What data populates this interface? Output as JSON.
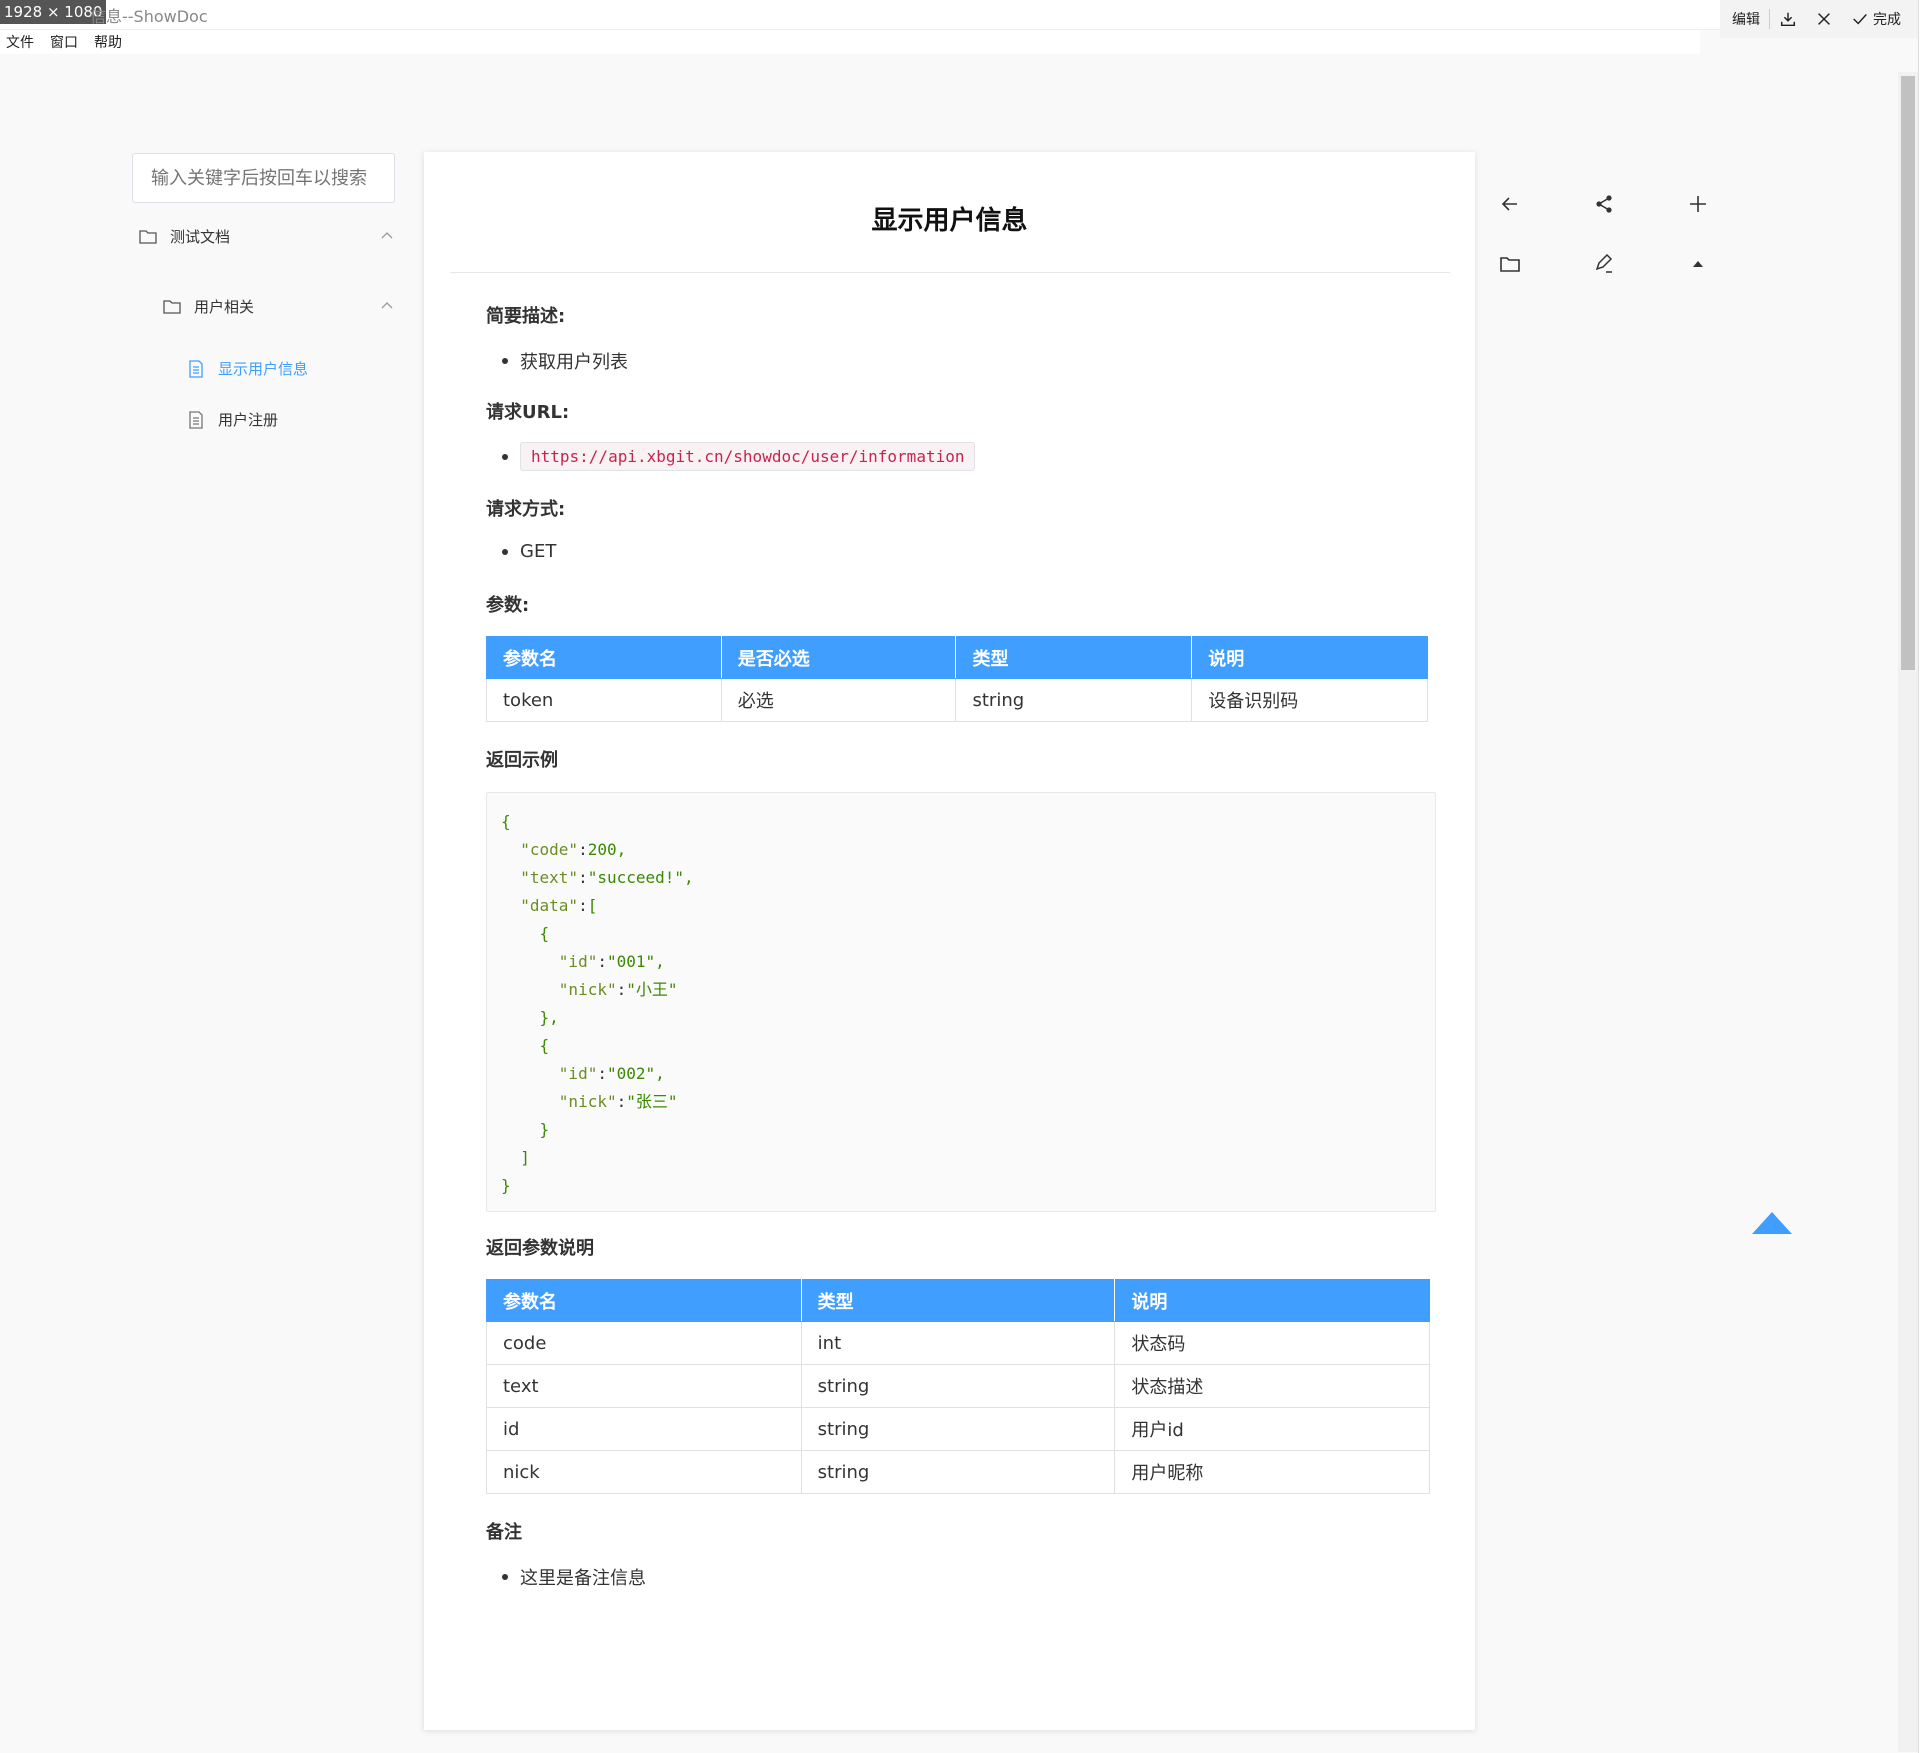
{
  "window": {
    "dimension_badge": "1928 × 1080",
    "title_fragment": "信息--ShowDoc"
  },
  "title_actions": {
    "edit_label": "编辑",
    "done_label": "完成"
  },
  "menubar": {
    "items": [
      "文件",
      "窗口",
      "帮助"
    ]
  },
  "sidebar": {
    "search_placeholder": "输入关键字后按回车以搜索",
    "tree": [
      {
        "label": "测试文档",
        "type": "folder"
      },
      {
        "label": "用户相关",
        "type": "folder"
      },
      {
        "label": "显示用户信息",
        "type": "page",
        "active": true
      },
      {
        "label": "用户注册",
        "type": "page"
      }
    ]
  },
  "doc": {
    "title": "显示用户信息",
    "desc_heading": "简要描述:",
    "desc_item": "获取用户列表",
    "url_heading": "请求URL:",
    "url_item": "https://api.xbgit.cn/showdoc/user/information",
    "method_heading": "请求方式:",
    "method_item": "GET",
    "params_heading": "参数:",
    "params_table": {
      "headers": [
        "参数名",
        "是否必选",
        "类型",
        "说明"
      ],
      "rows": [
        [
          "token",
          "必选",
          "string",
          "设备识别码"
        ]
      ]
    },
    "example_heading": "返回示例",
    "example_lines": [
      "{",
      "  \"code\":200,",
      "  \"text\":\"succeed!\",",
      "  \"data\":[",
      "    {",
      "      \"id\":\"001\",",
      "      \"nick\":\"小王\"",
      "    },",
      "    {",
      "      \"id\":\"002\",",
      "      \"nick\":\"张三\"",
      "    }",
      "  ]",
      "}"
    ],
    "return_heading": "返回参数说明",
    "return_table": {
      "headers": [
        "参数名",
        "类型",
        "说明"
      ],
      "rows": [
        [
          "code",
          "int",
          "状态码"
        ],
        [
          "text",
          "string",
          "状态描述"
        ],
        [
          "id",
          "string",
          "用户id"
        ],
        [
          "nick",
          "string",
          "用户昵称"
        ]
      ]
    },
    "note_heading": "备注",
    "note_item": "这里是备注信息"
  },
  "colors": {
    "accent": "#409eff",
    "url_code": "#c7254e"
  },
  "icons": {
    "toolbar": [
      "arrow-left-icon",
      "share-icon",
      "plus-icon",
      "folder-icon",
      "edit-icon",
      "caret-up-icon"
    ],
    "back_to_top": "triangle-up-icon"
  }
}
